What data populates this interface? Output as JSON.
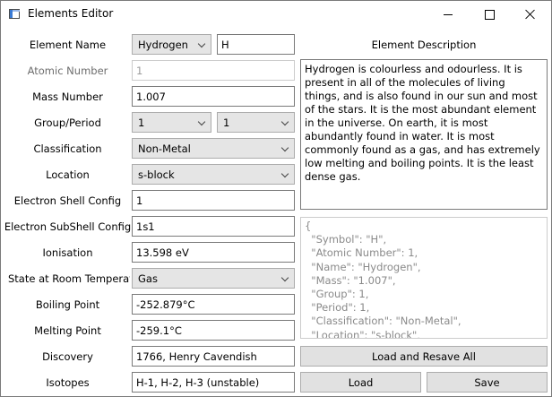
{
  "window": {
    "title": "Elements Editor"
  },
  "fields": {
    "element_name": {
      "label": "Element Name",
      "selected": "Hydrogen",
      "symbol": "H"
    },
    "atomic_number": {
      "label": "Atomic Number",
      "value": "1"
    },
    "mass_number": {
      "label": "Mass Number",
      "value": "1.007"
    },
    "group_period": {
      "label": "Group/Period",
      "group": "1",
      "period": "1"
    },
    "classification": {
      "label": "Classification",
      "selected": "Non-Metal"
    },
    "location": {
      "label": "Location",
      "selected": "s-block"
    },
    "electron_shell": {
      "label": "Electron Shell Config",
      "value": "1"
    },
    "electron_subshell": {
      "label": "Electron SubShell Config",
      "value": "1s1"
    },
    "ionisation": {
      "label": "Ionisation",
      "value": "13.598 eV"
    },
    "state": {
      "label": "State at Room Temperatu",
      "selected": "Gas"
    },
    "boiling_point": {
      "label": "Boiling Point",
      "value": "-252.879°C"
    },
    "melting_point": {
      "label": "Melting Point",
      "value": "-259.1°C"
    },
    "discovery": {
      "label": "Discovery",
      "value": "1766, Henry Cavendish"
    },
    "isotopes": {
      "label": "Isotopes",
      "value": "H-1, H-2, H-3 (unstable)"
    }
  },
  "description": {
    "label": "Element Description",
    "text": "Hydrogen is colourless and odourless. It is present in all of the molecules of living things, and is also found in our sun and most of the stars. It is the most abundant element in the universe. On earth, it is most abundantly found in water.  It is most commonly found as a gas, and has extremely low melting and boiling points. It is the least dense gas."
  },
  "json_preview": {
    "lines": [
      "{",
      "  \"Symbol\": \"H\",",
      "  \"Atomic Number\": 1,",
      "  \"Name\": \"Hydrogen\",",
      "  \"Mass\": \"1.007\",",
      "  \"Group\": 1,",
      "  \"Period\": 1,",
      "  \"Classification\": \"Non-Metal\",",
      "  \"Location\": \"s-block\","
    ]
  },
  "buttons": {
    "load_resave": "Load and Resave All",
    "load": "Load",
    "save": "Save"
  }
}
